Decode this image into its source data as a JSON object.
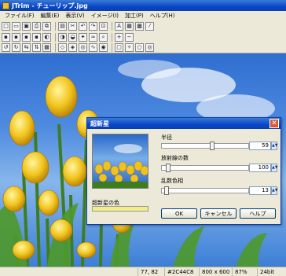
{
  "window": {
    "title": "JTrim - チューリップ.jpg"
  },
  "menu": [
    "ファイル(F)",
    "編集(E)",
    "表示(V)",
    "イメージ(I)",
    "加工(P)",
    "ヘルプ(H)"
  ],
  "toolbar1": {
    "icons": [
      "new-icon",
      "open-icon",
      "save-icon",
      "print-icon",
      "copy-icon",
      "paste-icon",
      "cut-icon",
      "undo-icon",
      "redo-icon",
      "crop-icon",
      "text-icon",
      "frame-icon",
      "palette-icon",
      "dropper-icon"
    ],
    "glyphs": [
      "□",
      "▭",
      "▣",
      "⎙",
      "⧉",
      "▤",
      "✂",
      "↶",
      "↷",
      "⊡",
      "A",
      "▦",
      "▩",
      "⁄"
    ]
  },
  "toolbar2": {
    "icons": [
      "grayscale-icon",
      "sepia-icon",
      "color-icon",
      "hsv-icon",
      "brightness-icon",
      "contrast-icon",
      "gamma-icon",
      "sharpen-icon",
      "blur-icon",
      "zoom-icon",
      "zoom-in-icon",
      "zoom-out-icon"
    ],
    "glyphs": [
      "▪",
      "▪",
      "▪",
      "▪",
      "◐",
      "◑",
      "◒",
      "✦",
      "≈",
      "⌕",
      "+",
      "−"
    ]
  },
  "toolbar3": {
    "icons": [
      "rotate-left-icon",
      "rotate-right-icon",
      "flip-h-icon",
      "flip-v-icon",
      "mosaic-icon",
      "emboss-icon",
      "oil-icon",
      "swirl-icon",
      "wave-icon",
      "spiral-icon",
      "frame-effect-icon",
      "star-icon",
      "circle-icon",
      "target-icon"
    ],
    "glyphs": [
      "↺",
      "↻",
      "⇆",
      "⇅",
      "▦",
      "◇",
      "◈",
      "◎",
      "∿",
      "◉",
      "▢",
      "✧",
      "○",
      "◎"
    ]
  },
  "status": {
    "coords": "77, 82",
    "color_code": "#2C44C8",
    "size": "800 x 600",
    "zoom": "87%",
    "depth": "24bit"
  },
  "dialog": {
    "title": "超新星",
    "color_label": "超新星の色",
    "color_value": "#f4ec84",
    "params": [
      {
        "label": "半径",
        "value": "59",
        "level": 0.59
      },
      {
        "label": "放射線の数",
        "value": "100",
        "level": 0.05
      },
      {
        "label": "乱数色相",
        "value": "13",
        "level": 0.03
      }
    ],
    "buttons": {
      "ok": "OK",
      "cancel": "キャンセル",
      "help": "ヘルプ"
    }
  }
}
